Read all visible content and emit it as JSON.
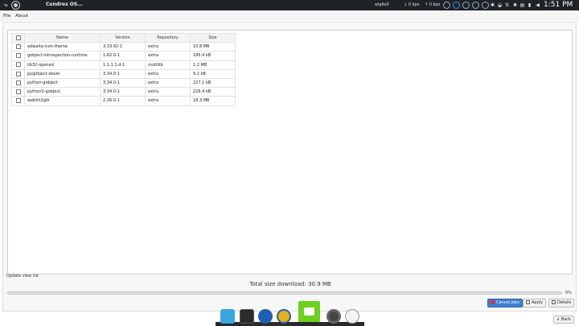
{
  "topbar": {
    "app_title": "Condres OS...",
    "net_interface": "wlp6s0",
    "net_down": "0 bps",
    "net_up": "0 bps",
    "clock": "1:51 PM"
  },
  "menubar": {
    "file": "File",
    "about": "About"
  },
  "table": {
    "headers": {
      "name": "Name",
      "version": "Version",
      "repository": "Repository",
      "size": "Size"
    },
    "rows": [
      {
        "name": "adwaita-icon-theme",
        "version": "3.33.92-1",
        "repository": "extra",
        "size": "10.8 MB"
      },
      {
        "name": "gobject-introspection-runtime",
        "version": "1.62.0-1",
        "repository": "extra",
        "size": "186.4 kB"
      },
      {
        "name": "lib32-openssl",
        "version": "1:1.1.1.d-1",
        "repository": "multilib",
        "size": "1.2 MB"
      },
      {
        "name": "pygobject-devel",
        "version": "3.34.0-1",
        "repository": "extra",
        "size": "9.2 kB"
      },
      {
        "name": "python-gobject",
        "version": "3.34.0-1",
        "repository": "extra",
        "size": "227.1 kB"
      },
      {
        "name": "python2-gobject",
        "version": "3.34.0-1",
        "repository": "extra",
        "size": "226.4 kB"
      },
      {
        "name": "webkit2gtk",
        "version": "2.26.0-1",
        "repository": "extra",
        "size": "18.3 MB"
      }
    ]
  },
  "status": {
    "message": "Update view list",
    "total": "Total size download: 30.9 MB",
    "progress_percent": 0,
    "progress_label": "0%"
  },
  "buttons": {
    "cancel": "Cancel Jobs",
    "apply": "Apply",
    "details": "Details",
    "back": "Back"
  },
  "colors": {
    "panel": "#1f2328",
    "accent": "#3c7fd6",
    "dock_active": "#6bd11b"
  },
  "dock": {
    "items": [
      "home-folder-icon",
      "terminal-icon",
      "browser-icon",
      "sync-icon",
      "screenshot-icon",
      "settings-icon",
      "clock-icon"
    ]
  }
}
